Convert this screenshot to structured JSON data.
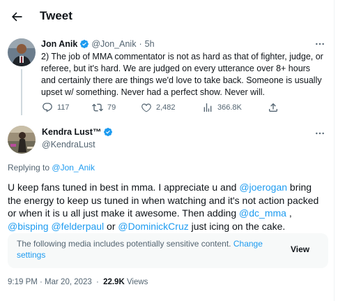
{
  "header": {
    "title": "Tweet"
  },
  "parent_tweet": {
    "author_name": "Jon Anik",
    "handle": "@Jon_Anik",
    "separator": "·",
    "time": "5h",
    "text": "2) The job of MMA commentator is not as hard as that of fighter, judge, or referee, but it's hard. We are judged on every utterance over 8+ hours and certainly there are things we'd love to take back. Someone is usually upset w/ something. Never had a perfect show. Never will.",
    "actions": {
      "replies": "117",
      "retweets": "79",
      "likes": "2,482",
      "views": "366.8K"
    }
  },
  "main_tweet": {
    "author_name": "Kendra Lust™",
    "handle": "@KendraLust",
    "replying_label": "Replying to",
    "replying_to": "@Jon_Anik",
    "text_parts": {
      "p1": "U keep fans tuned in best in mma. I appreciate u and ",
      "m1": "@joerogan",
      "p2": " bring the energy to keep us tuned in when watching and it's not action packed or when it is u all just make it awesome. Then adding ",
      "m2": "@dc_mma",
      "p3": " , ",
      "m3": "@bisping",
      "p4": " ",
      "m4": "@felderpaul",
      "p5": " or ",
      "m5": "@DominickCruz",
      "p6": " just icing on the cake."
    },
    "sensitive_notice": {
      "text": "The following media includes potentially sensitive content.",
      "link": "Change settings",
      "button": "View"
    },
    "timestamp": "9:19 PM · Mar 20, 2023",
    "views_separator": "·",
    "views_count": "22.9K",
    "views_label": "Views"
  },
  "colors": {
    "accent": "#1d9bf0",
    "text": "#0f1419",
    "muted": "#536471",
    "panel": "#f7f9f9"
  }
}
